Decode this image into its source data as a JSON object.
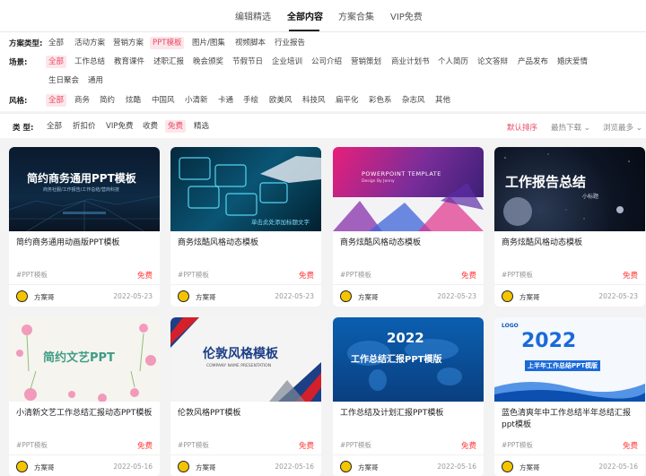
{
  "top_tabs": [
    {
      "label": "编辑精选",
      "active": false
    },
    {
      "label": "全部内容",
      "active": true
    },
    {
      "label": "方案合集",
      "active": false
    },
    {
      "label": "VIP免费",
      "active": false
    }
  ],
  "filters": {
    "type": {
      "label": "方案类型:",
      "options": [
        "全部",
        "活动方案",
        "营销方案",
        "PPT模板",
        "图片/图集",
        "视频脚本",
        "行业报告"
      ],
      "selected": 3
    },
    "scene": {
      "label": "场景:",
      "options": [
        "全部",
        "工作总结",
        "教育课件",
        "述职汇报",
        "晚会颁奖",
        "节假节日",
        "企业培训",
        "公司介绍",
        "营销策划",
        "商业计划书",
        "个人简历",
        "论文答辩",
        "产品发布",
        "婚庆爱情",
        "生日聚会",
        "通用"
      ],
      "selected": 0
    },
    "style": {
      "label": "风格:",
      "options": [
        "全部",
        "商务",
        "简约",
        "炫酷",
        "中国风",
        "小清新",
        "卡通",
        "手绘",
        "欧美风",
        "科技风",
        "扁平化",
        "彩色系",
        "杂志风",
        "其他"
      ],
      "selected": 0
    }
  },
  "sortbar": {
    "label": "类  型:",
    "options": [
      "全部",
      "折扣价",
      "VIP免费",
      "收费",
      "免费",
      "精选"
    ],
    "selected": 4,
    "sorts": [
      {
        "label": "默认排序",
        "active": true
      },
      {
        "label": "最热下载 ⌄",
        "active": false
      },
      {
        "label": "浏览最多 ⌄",
        "active": false
      }
    ]
  },
  "cards": [
    {
      "title": "简约商务通用动画版PPT模板",
      "tag": "#PPT模板",
      "price": "免费",
      "author": "方案哥",
      "date": "2022-05-23",
      "thumb": {
        "headline": "简约商务通用PPT模板",
        "sub": "商务社服/工作报告/工作总结/营商科技"
      }
    },
    {
      "title": "商务炫酷风格动态模板",
      "tag": "#PPT模板",
      "price": "免费",
      "author": "方案哥",
      "date": "2022-05-23",
      "thumb": {
        "headline": "单击此处添加标题文字"
      }
    },
    {
      "title": "商务炫酷风格动态模板",
      "tag": "#PPT模板",
      "price": "免费",
      "author": "方案哥",
      "date": "2022-05-23",
      "thumb": {
        "headline": "POWERPOINT TEMPLATE",
        "sub": "Design By Jenny"
      }
    },
    {
      "title": "商务炫酷风格动态模板",
      "tag": "#PPT模板",
      "price": "免费",
      "author": "方案哥",
      "date": "2022-05-23",
      "thumb": {
        "headline": "工作报告总结",
        "sub": "小标题"
      }
    },
    {
      "title": "小清新文艺工作总结汇报动态PPT模板",
      "tag": "#PPT模板",
      "price": "免费",
      "author": "方案哥",
      "date": "2022-05-16",
      "thumb": {
        "headline": "简约文艺PPT"
      }
    },
    {
      "title": "伦敦风格PPT模板",
      "tag": "#PPT模板",
      "price": "免费",
      "author": "方案哥",
      "date": "2022-05-16",
      "thumb": {
        "headline": "伦敦风格模板",
        "sub": "COMPANY NAME PRESENTATION"
      }
    },
    {
      "title": "工作总结及计划汇报PPT模板",
      "tag": "#PPT模板",
      "price": "免费",
      "author": "方案哥",
      "date": "2022-05-16",
      "thumb": {
        "headline": "2022",
        "sub": "工作总结汇报PPT模版"
      }
    },
    {
      "title": "蓝色清爽年中工作总结半年总结汇报ppt模板",
      "tag": "#PPT模板",
      "price": "免费",
      "author": "方案哥",
      "date": "2022-05-16",
      "thumb": {
        "headline": "2022",
        "sub": "上半年工作总结PPT模版",
        "logo": "LOGO"
      }
    }
  ]
}
